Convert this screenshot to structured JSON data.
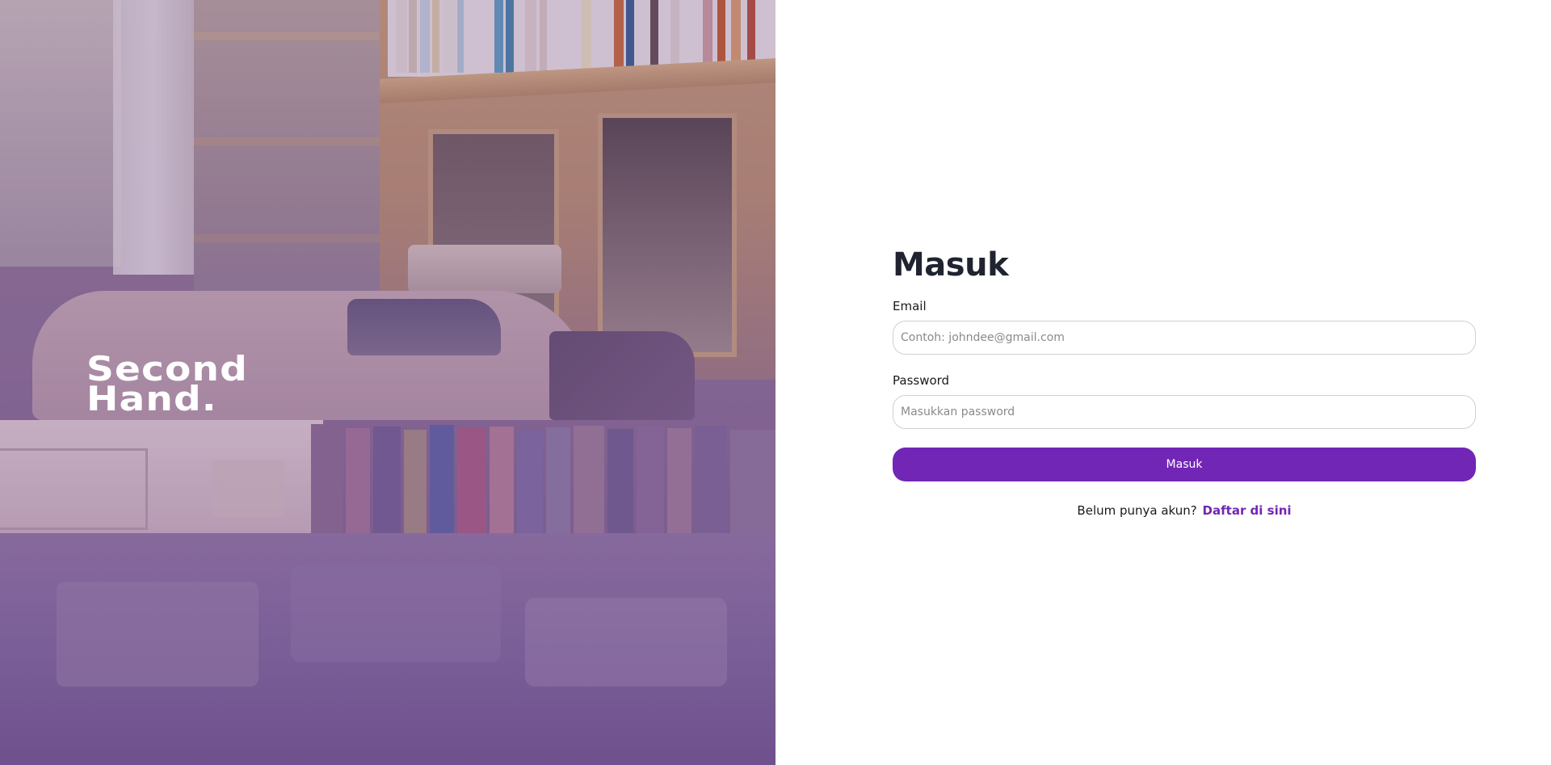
{
  "brand": {
    "name": "Second\nHand."
  },
  "login": {
    "title": "Masuk",
    "email_label": "Email",
    "email_placeholder": "Contoh: johndee@gmail.com",
    "email_value": "",
    "password_label": "Password",
    "password_placeholder": "Masukkan password",
    "password_value": "",
    "submit_label": "Masuk",
    "register_prompt": "Belum punya akun?",
    "register_link": "Daftar di sini"
  },
  "colors": {
    "primary": "#7126b5",
    "hero_tint": "#8a6ba0",
    "text": "#1f2430"
  }
}
